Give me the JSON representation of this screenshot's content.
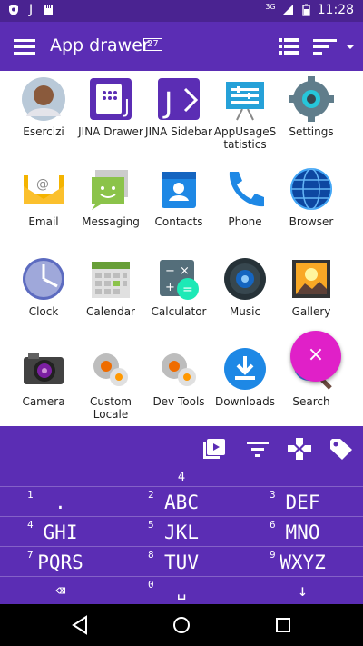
{
  "status": {
    "left_icons": [
      "shield-icon",
      "j-icon",
      "sd-card-icon"
    ],
    "network": "3G",
    "time": "11:28"
  },
  "appbar": {
    "title": "App drawer",
    "count": "27"
  },
  "apps": [
    {
      "label": "Esercizi",
      "icon": "contact-photo-icon"
    },
    {
      "label": "JINA Drawer",
      "icon": "jina-drawer-icon"
    },
    {
      "label": "JINA Sidebar",
      "icon": "jina-sidebar-icon"
    },
    {
      "label": "AppUsageS tatistics",
      "icon": "app-usage-icon"
    },
    {
      "label": "Settings",
      "icon": "settings-icon"
    },
    {
      "label": "Email",
      "icon": "email-icon"
    },
    {
      "label": "Messaging",
      "icon": "messaging-icon"
    },
    {
      "label": "Contacts",
      "icon": "contacts-icon"
    },
    {
      "label": "Phone",
      "icon": "phone-icon"
    },
    {
      "label": "Browser",
      "icon": "browser-icon"
    },
    {
      "label": "Clock",
      "icon": "clock-icon"
    },
    {
      "label": "Calendar",
      "icon": "calendar-icon"
    },
    {
      "label": "Calculator",
      "icon": "calculator-icon"
    },
    {
      "label": "Music",
      "icon": "music-icon"
    },
    {
      "label": "Gallery",
      "icon": "gallery-icon"
    },
    {
      "label": "Camera",
      "icon": "camera-icon"
    },
    {
      "label": "Custom Locale",
      "icon": "custom-locale-icon"
    },
    {
      "label": "Dev Tools",
      "icon": "dev-tools-icon"
    },
    {
      "label": "Downloads",
      "icon": "downloads-icon"
    },
    {
      "label": "Search",
      "icon": "search-icon"
    }
  ],
  "fab": {
    "label": "×"
  },
  "keypad": {
    "entered": "4",
    "keys": [
      {
        "num": "1",
        "letters": "."
      },
      {
        "num": "2",
        "letters": "ABC"
      },
      {
        "num": "3",
        "letters": "DEF"
      },
      {
        "num": "4",
        "letters": "GHI"
      },
      {
        "num": "5",
        "letters": "JKL"
      },
      {
        "num": "6",
        "letters": "MNO"
      },
      {
        "num": "7",
        "letters": "PQRS"
      },
      {
        "num": "8",
        "letters": "TUV"
      },
      {
        "num": "9",
        "letters": "WXYZ"
      },
      {
        "num": "",
        "letters": "⌫"
      },
      {
        "num": "0",
        "letters": "␣"
      },
      {
        "num": "",
        "letters": "↓"
      }
    ]
  },
  "colors": {
    "primary": "#5b2db4",
    "status": "#4a2391",
    "accent": "#e020c8"
  }
}
